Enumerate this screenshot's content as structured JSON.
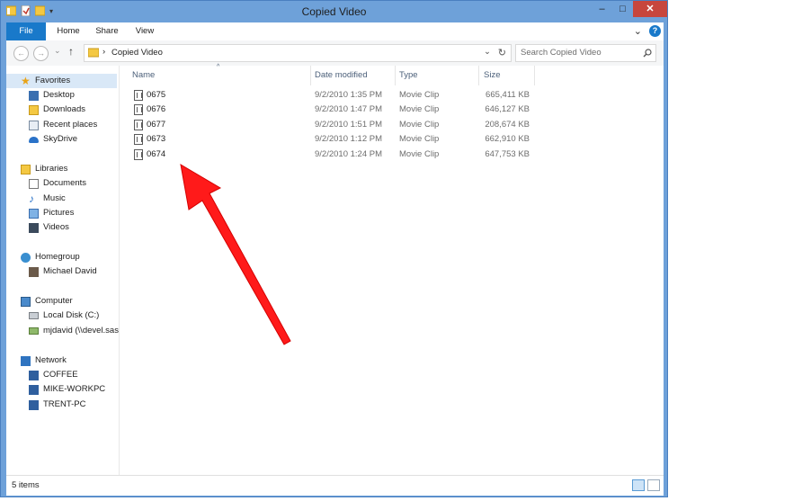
{
  "window": {
    "title": "Copied Video"
  },
  "controls": {
    "minimize": "–",
    "maximize": "□",
    "close": "✕"
  },
  "ribbon": {
    "tabs": [
      "File",
      "Home",
      "Share",
      "View"
    ],
    "expand": "⌄",
    "help": "?"
  },
  "address": {
    "back": "←",
    "forward": "→",
    "recent": "⌄",
    "up": "↑",
    "sep": "›",
    "path": "Copied Video",
    "dropdown": "⌄",
    "refresh": "↻"
  },
  "search": {
    "placeholder": "Search Copied Video",
    "icon": "search-icon"
  },
  "nav": {
    "favorites": {
      "label": "Favorites",
      "items": [
        "Desktop",
        "Downloads",
        "Recent places",
        "SkyDrive"
      ]
    },
    "libraries": {
      "label": "Libraries",
      "items": [
        "Documents",
        "Music",
        "Pictures",
        "Videos"
      ]
    },
    "homegroup": {
      "label": "Homegroup",
      "items": [
        "Michael David"
      ]
    },
    "computer": {
      "label": "Computer",
      "items": [
        "Local Disk (C:)",
        "mjdavid (\\\\devel.sas"
      ]
    },
    "network": {
      "label": "Network",
      "items": [
        "COFFEE",
        "MIKE-WORKPC",
        "TRENT-PC"
      ]
    }
  },
  "columns": {
    "name": "Name",
    "date": "Date modified",
    "type": "Type",
    "size": "Size"
  },
  "files": [
    {
      "name": "0675",
      "date": "9/2/2010 1:35 PM",
      "type": "Movie Clip",
      "size": "665,411 KB"
    },
    {
      "name": "0676",
      "date": "9/2/2010 1:47 PM",
      "type": "Movie Clip",
      "size": "646,127 KB"
    },
    {
      "name": "0677",
      "date": "9/2/2010 1:51 PM",
      "type": "Movie Clip",
      "size": "208,674 KB"
    },
    {
      "name": "0673",
      "date": "9/2/2010 1:12 PM",
      "type": "Movie Clip",
      "size": "662,910 KB"
    },
    {
      "name": "0674",
      "date": "9/2/2010 1:24 PM",
      "type": "Movie Clip",
      "size": "647,753 KB"
    }
  ],
  "status": {
    "items": "5 items"
  },
  "colors": {
    "frame": "#6ea1d9",
    "file_tab": "#1979ca",
    "close": "#c7463d",
    "arrow": "#ff1a1a",
    "selection": "#d9e8f7"
  }
}
